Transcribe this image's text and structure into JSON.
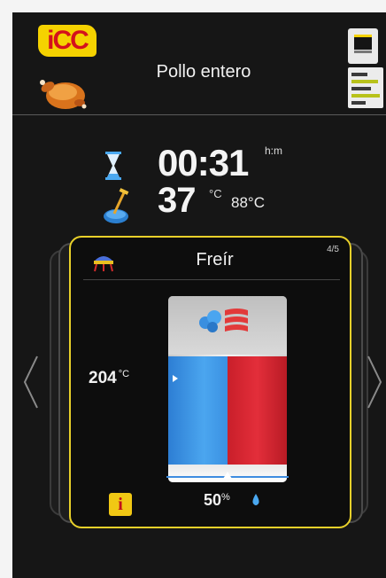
{
  "header": {
    "logo_text": "iCC",
    "title": "Pollo entero"
  },
  "status": {
    "time_value": "00:31",
    "time_unit": "h:m",
    "core_temp_value": "37",
    "core_temp_unit": "°C",
    "target_core_temp": "88°C"
  },
  "step": {
    "name": "Freír",
    "counter": "4/5",
    "cabinet_temp_value": "204",
    "cabinet_temp_unit": "°C",
    "humidity_value": "50",
    "humidity_unit": "%",
    "humidity_level": 0.5,
    "info_label": "i"
  },
  "colors": {
    "accent_yellow": "#e8d02a",
    "dry_heat_blue": "#3a90e2",
    "humid_red": "#e32e3a",
    "background": "#161616"
  },
  "icons": [
    "icc-logo",
    "chicken-icon",
    "cabinet-icon",
    "program-list-icon",
    "hourglass-icon",
    "core-probe-icon",
    "fry-icon",
    "steam-icon",
    "drop-icon",
    "arrow-left-icon",
    "arrow-right-icon"
  ]
}
